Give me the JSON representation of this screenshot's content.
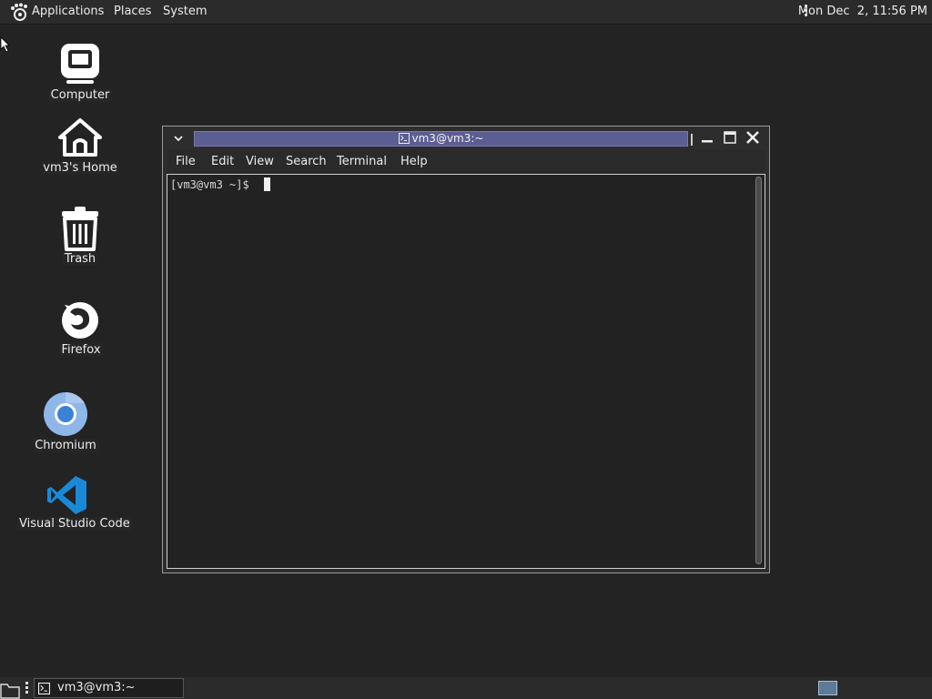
{
  "top_panel": {
    "menus": [
      "Applications",
      "Places",
      "System"
    ],
    "clock": "Mon Dec  2, 11:56 PM"
  },
  "desktop": {
    "icons": [
      {
        "label": "Computer",
        "icon": "computer-icon"
      },
      {
        "label": "vm3's Home",
        "icon": "home-icon"
      },
      {
        "label": "Trash",
        "icon": "trash-icon"
      },
      {
        "label": "Firefox",
        "icon": "firefox-icon"
      },
      {
        "label": "Chromium",
        "icon": "chromium-icon"
      },
      {
        "label": "Visual Studio Code",
        "icon": "vscode-icon"
      }
    ]
  },
  "terminal": {
    "title": "vm3@vm3:~",
    "menu": [
      "File",
      "Edit",
      "View",
      "Search",
      "Terminal",
      "Help"
    ],
    "prompt": "[vm3@vm3 ~]$ "
  },
  "taskbar": {
    "task_label": "vm3@vm3:~"
  },
  "colors": {
    "desktop_bg": "#232323",
    "title_highlight": "#5c5d92",
    "vscode_blue": "#1a8ad8",
    "chromium_blue": "#3b82d6"
  }
}
